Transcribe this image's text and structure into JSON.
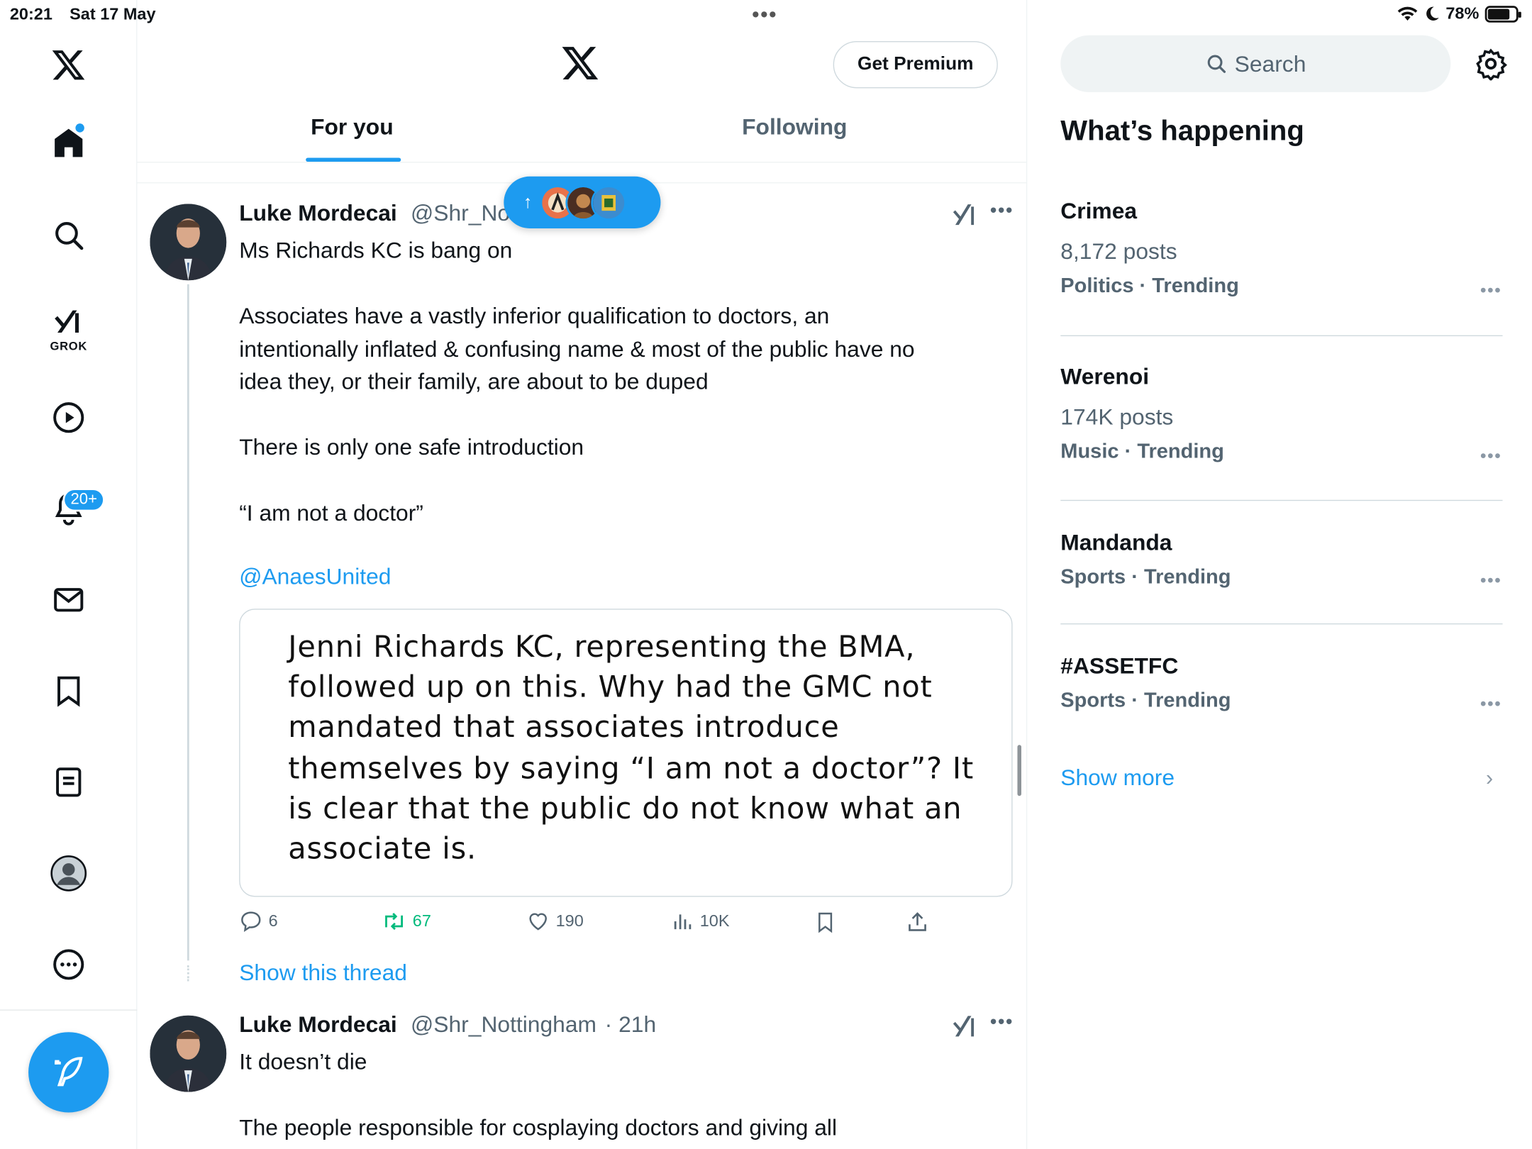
{
  "status_bar": {
    "time": "20:21",
    "date": "Sat 17 May",
    "battery": "78%"
  },
  "nav": {
    "grok_label": "GROK",
    "notifications_badge": "20+",
    "compose_label": "Post"
  },
  "header": {
    "premium_button": "Get Premium",
    "tabs": [
      {
        "label": "For you",
        "active": true
      },
      {
        "label": "Following",
        "active": false
      }
    ]
  },
  "posts": [
    {
      "author": "Luke Mordecai",
      "handle": "@Shr_No",
      "text_lines": [
        "Ms Richards KC is bang on",
        "",
        "Associates have a vastly inferior qualification to doctors, an",
        "intentionally inflated & confusing name & most of the public have no",
        "idea they, or their family, are about to be duped",
        "",
        "There is only one safe introduction",
        "",
        "“I am not a doctor”"
      ],
      "mention": "@AnaesUnited",
      "media_text_lines": [
        "Jenni Richards KC, representing the BMA,",
        "followed up on this. Why had the GMC not",
        "mandated that associates introduce",
        "themselves by saying “I am not a doctor”? It",
        "is clear that the public do not know what an",
        "associate is."
      ],
      "replies": "6",
      "reposts": "67",
      "likes": "190",
      "views": "10K",
      "show_thread": "Show this thread"
    },
    {
      "author": "Luke Mordecai",
      "handle": "@Shr_Nottingham",
      "time": "· 21h",
      "text_lines": [
        "It doesn’t die",
        "",
        "The people responsible for cosplaying doctors and giving all"
      ]
    }
  ],
  "sidebar": {
    "search_placeholder": "Search",
    "heading": "What’s happening",
    "trends": [
      {
        "name": "Crimea",
        "count": "8,172 posts",
        "category": "Politics · Trending"
      },
      {
        "name": "Werenoi",
        "count": "174K posts",
        "category": "Music · Trending"
      },
      {
        "name": "Mandanda",
        "count": "",
        "category": "Sports · Trending"
      },
      {
        "name": "#ASSETFC",
        "count": "",
        "category": "Sports · Trending"
      }
    ],
    "show_more": "Show more"
  },
  "colors": {
    "accent": "#1d9bf0",
    "repost": "#00ba7c",
    "secondary_text": "#536471"
  }
}
